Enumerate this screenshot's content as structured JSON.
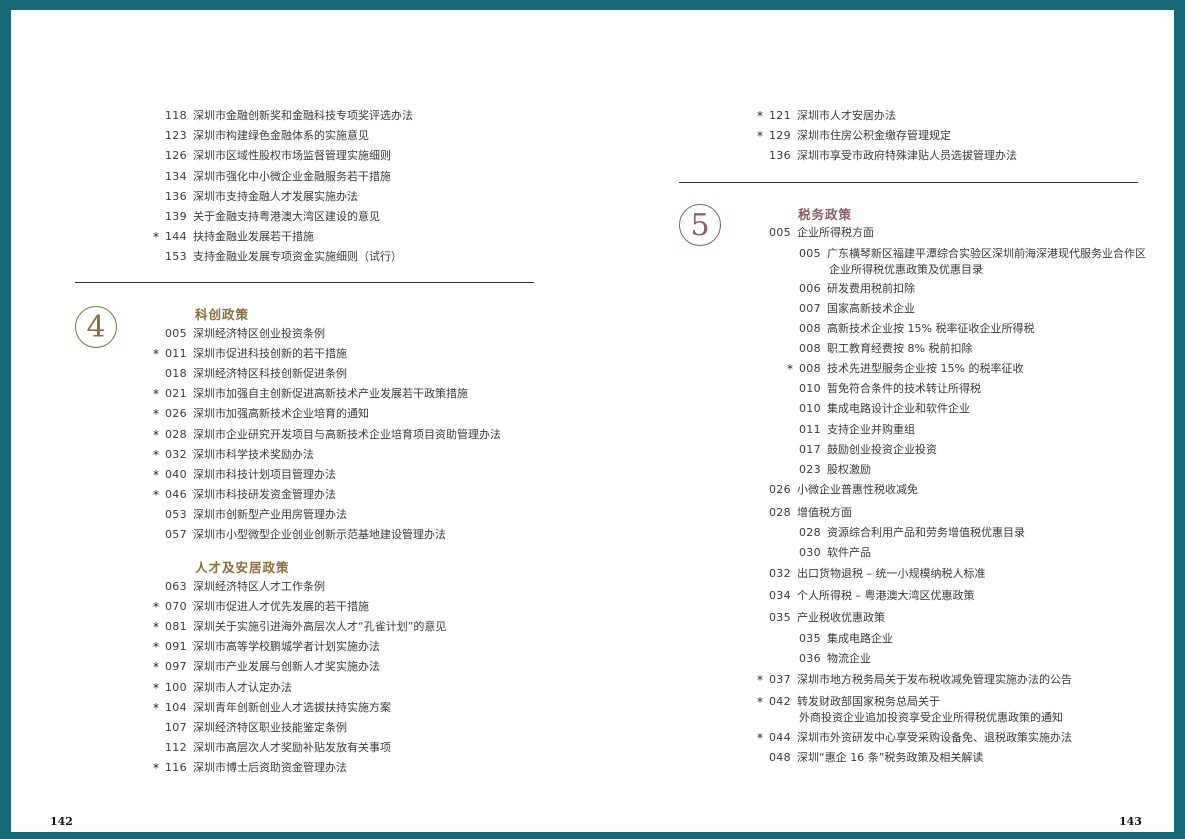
{
  "left_page": {
    "top_list": [
      {
        "star": false,
        "num": "118",
        "title": "深圳市金融创新奖和金融科技专项奖评选办法"
      },
      {
        "star": false,
        "num": "123",
        "title": "深圳市构建绿色金融体系的实施意见"
      },
      {
        "star": false,
        "num": "126",
        "title": "深圳市区域性股权市场监督管理实施细则"
      },
      {
        "star": false,
        "num": "134",
        "title": "深圳市强化中小微企业金融服务若干措施"
      },
      {
        "star": false,
        "num": "136",
        "title": "深圳市支持金融人才发展实施办法"
      },
      {
        "star": false,
        "num": "139",
        "title": "关于金融支持粤港澳大湾区建设的意见"
      },
      {
        "star": true,
        "num": "144",
        "title": "扶持金融业发展若干措施"
      },
      {
        "star": false,
        "num": "153",
        "title": "支持金融业发展专项资金实施细则（试行）"
      }
    ],
    "section4": {
      "number": "4",
      "title": "科创政策",
      "items": [
        {
          "star": false,
          "num": "005",
          "title": "深圳经济特区创业投资条例"
        },
        {
          "star": true,
          "num": "011",
          "title": "深圳市促进科技创新的若干措施"
        },
        {
          "star": false,
          "num": "018",
          "title": "深圳经济特区科技创新促进条例"
        },
        {
          "star": true,
          "num": "021",
          "title": "深圳市加强自主创新促进高新技术产业发展若干政策措施"
        },
        {
          "star": true,
          "num": "026",
          "title": "深圳市加强高新技术企业培育的通知"
        },
        {
          "star": true,
          "num": "028",
          "title": "深圳市企业研究开发项目与高新技术企业培育项目资助管理办法"
        },
        {
          "star": true,
          "num": "032",
          "title": "深圳市科学技术奖励办法"
        },
        {
          "star": true,
          "num": "040",
          "title": "深圳市科技计划项目管理办法"
        },
        {
          "star": true,
          "num": "046",
          "title": "深圳市科技研发资金管理办法"
        },
        {
          "star": false,
          "num": "053",
          "title": "深圳市创新型产业用房管理办法"
        },
        {
          "star": false,
          "num": "057",
          "title": "深圳市小型微型企业创业创新示范基地建设管理办法"
        }
      ]
    },
    "talent": {
      "title": "人才及安居政策",
      "items": [
        {
          "star": false,
          "num": "063",
          "title": "深圳经济特区人才工作条例"
        },
        {
          "star": true,
          "num": "070",
          "title": "深圳市促进人才优先发展的若干措施"
        },
        {
          "star": true,
          "num": "081",
          "title": "深圳关于实施引进海外高层次人才“孔雀计划”的意见"
        },
        {
          "star": true,
          "num": "091",
          "title": "深圳市高等学校鹏城学者计划实施办法"
        },
        {
          "star": true,
          "num": "097",
          "title": "深圳市产业发展与创新人才奖实施办法"
        },
        {
          "star": true,
          "num": "100",
          "title": "深圳市人才认定办法"
        },
        {
          "star": true,
          "num": "104",
          "title": "深圳青年创新创业人才选拔扶持实施方案"
        },
        {
          "star": false,
          "num": "107",
          "title": "深圳经济特区职业技能鉴定条例"
        },
        {
          "star": false,
          "num": "112",
          "title": "深圳市高层次人才奖励补贴发放有关事项"
        },
        {
          "star": true,
          "num": "116",
          "title": "深圳市博士后资助资金管理办法"
        }
      ]
    },
    "page_number": "142"
  },
  "right_page": {
    "top_list": [
      {
        "star": true,
        "num": "121",
        "title": "深圳市人才安居办法"
      },
      {
        "star": true,
        "num": "129",
        "title": "深圳市住房公积金缴存管理规定"
      },
      {
        "star": false,
        "num": "136",
        "title": "深圳市享受市政府特殊津贴人员选拔管理办法"
      }
    ],
    "section5": {
      "number": "5",
      "title": "税务政策",
      "items": [
        {
          "level": 0,
          "star": false,
          "num": "005",
          "title": "企业所得税方面"
        },
        {
          "level": 1,
          "star": false,
          "num": "005",
          "title": "广东横琴新区福建平潭综合实验区深圳前海深港现代服务业合作区",
          "title2": "企业所得税优惠政策及优惠目录"
        },
        {
          "level": 1,
          "star": false,
          "num": "006",
          "title": "研发费用税前扣除"
        },
        {
          "level": 1,
          "star": false,
          "num": "007",
          "title": "国家高新技术企业"
        },
        {
          "level": 1,
          "star": false,
          "num": "008",
          "title": "高新技术企业按 15% 税率征收企业所得税"
        },
        {
          "level": 1,
          "star": false,
          "num": "008",
          "title": "职工教育经费按 8% 税前扣除"
        },
        {
          "level": 1,
          "star": true,
          "num": "008",
          "title": "技术先进型服务企业按 15% 的税率征收"
        },
        {
          "level": 1,
          "star": false,
          "num": "010",
          "title": "暂免符合条件的技术转让所得税"
        },
        {
          "level": 1,
          "star": false,
          "num": "010",
          "title": "集成电路设计企业和软件企业"
        },
        {
          "level": 1,
          "star": false,
          "num": "011",
          "title": "支持企业并购重组"
        },
        {
          "level": 1,
          "star": false,
          "num": "017",
          "title": "鼓励创业投资企业投资"
        },
        {
          "level": 1,
          "star": false,
          "num": "023",
          "title": "股权激励"
        },
        {
          "level": 0,
          "star": false,
          "num": "026",
          "title": "小微企业普惠性税收减免"
        },
        {
          "level": 0,
          "star": false,
          "num": "028",
          "title": "增值税方面"
        },
        {
          "level": 1,
          "star": false,
          "num": "028",
          "title": "资源综合利用产品和劳务增值税优惠目录"
        },
        {
          "level": 1,
          "star": false,
          "num": "030",
          "title": "软件产品"
        },
        {
          "level": 0,
          "star": false,
          "num": "032",
          "title": "出口货物退税 – 统一小规模纳税人标准"
        },
        {
          "level": 0,
          "star": false,
          "num": "034",
          "title": "个人所得税 – 粤港澳大湾区优惠政策"
        },
        {
          "level": 0,
          "star": false,
          "num": "035",
          "title": "产业税收优惠政策"
        },
        {
          "level": 1,
          "star": false,
          "num": "035",
          "title": "集成电路企业"
        },
        {
          "level": 1,
          "star": false,
          "num": "036",
          "title": "物流企业"
        },
        {
          "level": 0,
          "star": true,
          "num": "037",
          "title": "深圳市地方税务局关于发布税收减免管理实施办法的公告"
        },
        {
          "level": 0,
          "star": true,
          "num": "042",
          "title": "转发财政部国家税务总局关于",
          "title2": "外商投资企业追加投资享受企业所得税优惠政策的通知"
        },
        {
          "level": 0,
          "star": true,
          "num": "044",
          "title": "深圳市外资研发中心享受采购设备免、退税政策实施办法"
        },
        {
          "level": 0,
          "star": false,
          "num": "048",
          "title": "深圳“惠企 16 条”税务政策及相关解读"
        }
      ]
    },
    "page_number": "143"
  },
  "colors": {
    "background": "#17697a",
    "accent_brown": "#8a6e3c",
    "accent_rose": "#8c5f63"
  }
}
